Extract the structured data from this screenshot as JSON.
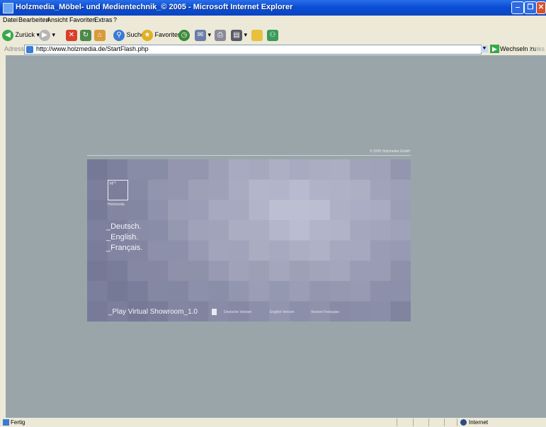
{
  "window": {
    "title": "Holzmedia_Möbel- und Medientechnik_© 2005 - Microsoft Internet Explorer",
    "minimize": "‒",
    "maximize": "❐",
    "close": "✕"
  },
  "menu": [
    "Datei",
    "Bearbeiten",
    "Ansicht",
    "Favoriten",
    "Extras",
    "?"
  ],
  "toolbar": {
    "back": "Zurück",
    "search": "Suchen",
    "favorites": "Favoriten"
  },
  "address": {
    "label": "Adresse",
    "url": "http://www.holzmedia.de/StartFlash.php",
    "go": "Wechseln zu",
    "links": "Links"
  },
  "page": {
    "copyright": "© 2005 Holzmedia GmbH",
    "logo_mark": "H°°",
    "logo_name": "Holzmedia",
    "languages": [
      "_Deutsch.",
      "_English.",
      "_Français."
    ],
    "play_label": "_Play Virtual Showroom_1.0",
    "versions": [
      "Deutsche Version",
      "English Version",
      "Version Française"
    ]
  },
  "status": {
    "text": "Fertig",
    "zone": "Internet"
  }
}
